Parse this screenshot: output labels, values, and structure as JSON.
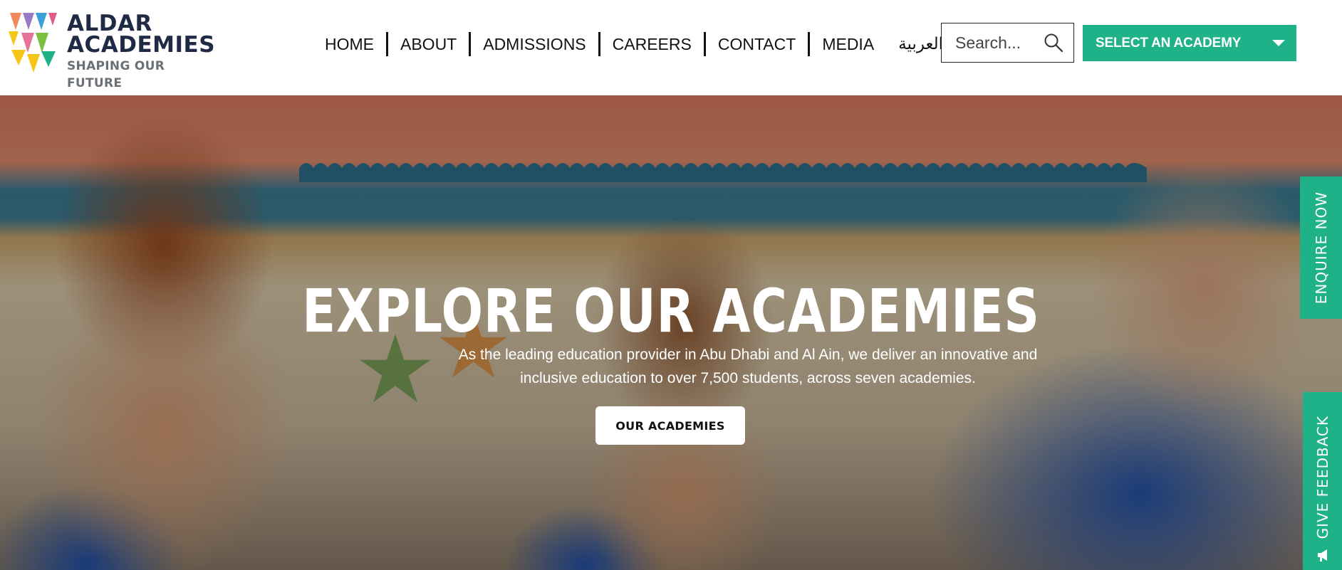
{
  "brand": {
    "name_line1": "ALDAR",
    "name_line2": "ACADEMIES",
    "tagline": "SHAPING OUR FUTURE",
    "colors": {
      "accent": "#1fb289",
      "navy": "#1f2a44",
      "logo_orange": "#f08a5d",
      "logo_purple": "#8e6bbf",
      "logo_green": "#7ac143",
      "logo_yellow": "#f5c518",
      "logo_blue": "#3aa0d8",
      "logo_pink": "#e05a8a"
    }
  },
  "nav": {
    "items": [
      "HOME",
      "ABOUT",
      "ADMISSIONS",
      "CAREERS",
      "CONTACT",
      "MEDIA"
    ],
    "language_link": "العربية"
  },
  "search": {
    "placeholder": "Search...",
    "icon": "search-icon"
  },
  "academy_select": {
    "label": "SELECT AN ACADEMY",
    "icon": "chevron-down-icon"
  },
  "hero": {
    "title": "EXPLORE OUR ACADEMIES",
    "description_line1": "As the leading education provider in Abu Dhabi and Al Ain, we deliver an innovative and",
    "description_line2": "inclusive education to over 7,500 students, across seven academies.",
    "cta_label": "OUR ACADEMIES"
  },
  "side_tabs": {
    "enquire": "ENQUIRE NOW",
    "feedback": "GIVE FEEDBACK",
    "feedback_icon": "megaphone-icon"
  }
}
